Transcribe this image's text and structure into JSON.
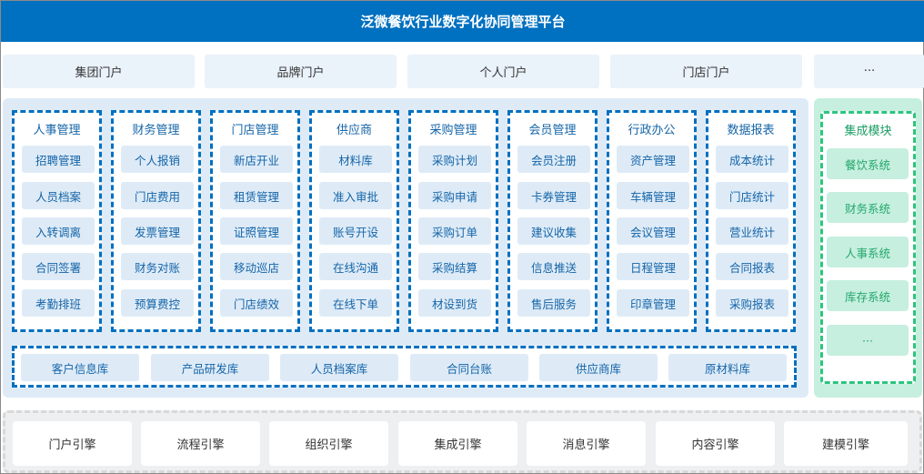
{
  "title": "泛微餐饮行业数字化协同管理平台",
  "portals": [
    "集团门户",
    "品牌门户",
    "个人门户",
    "门店门户",
    "···"
  ],
  "modules": [
    {
      "title": "人事管理",
      "items": [
        "招聘管理",
        "人员档案",
        "入转调离",
        "合同签署",
        "考勤排班"
      ]
    },
    {
      "title": "财务管理",
      "items": [
        "个人报销",
        "门店费用",
        "发票管理",
        "财务对账",
        "预算费控"
      ]
    },
    {
      "title": "门店管理",
      "items": [
        "新店开业",
        "租赁管理",
        "证照管理",
        "移动巡店",
        "门店绩效"
      ]
    },
    {
      "title": "供应商",
      "items": [
        "材料库",
        "准入审批",
        "账号开设",
        "在线沟通",
        "在线下单"
      ]
    },
    {
      "title": "采购管理",
      "items": [
        "采购计划",
        "采购申请",
        "采购订单",
        "采购结算",
        "材设到货"
      ]
    },
    {
      "title": "会员管理",
      "items": [
        "会员注册",
        "卡券管理",
        "建议收集",
        "信息推送",
        "售后服务"
      ]
    },
    {
      "title": "行政办公",
      "items": [
        "资产管理",
        "车辆管理",
        "会议管理",
        "日程管理",
        "印章管理"
      ]
    },
    {
      "title": "数据报表",
      "items": [
        "成本统计",
        "门店统计",
        "营业统计",
        "合同报表",
        "采购报表"
      ]
    }
  ],
  "libraries": [
    "客户信息库",
    "产品研发库",
    "人员档案库",
    "合同台账",
    "供应商库",
    "原材料库"
  ],
  "integration": {
    "title": "集成模块",
    "items": [
      "餐饮系统",
      "财务系统",
      "人事系统",
      "库存系统",
      "···"
    ]
  },
  "engines": [
    "门户引擎",
    "流程引擎",
    "组织引擎",
    "集成引擎",
    "消息引擎",
    "内容引擎",
    "建模引擎"
  ]
}
